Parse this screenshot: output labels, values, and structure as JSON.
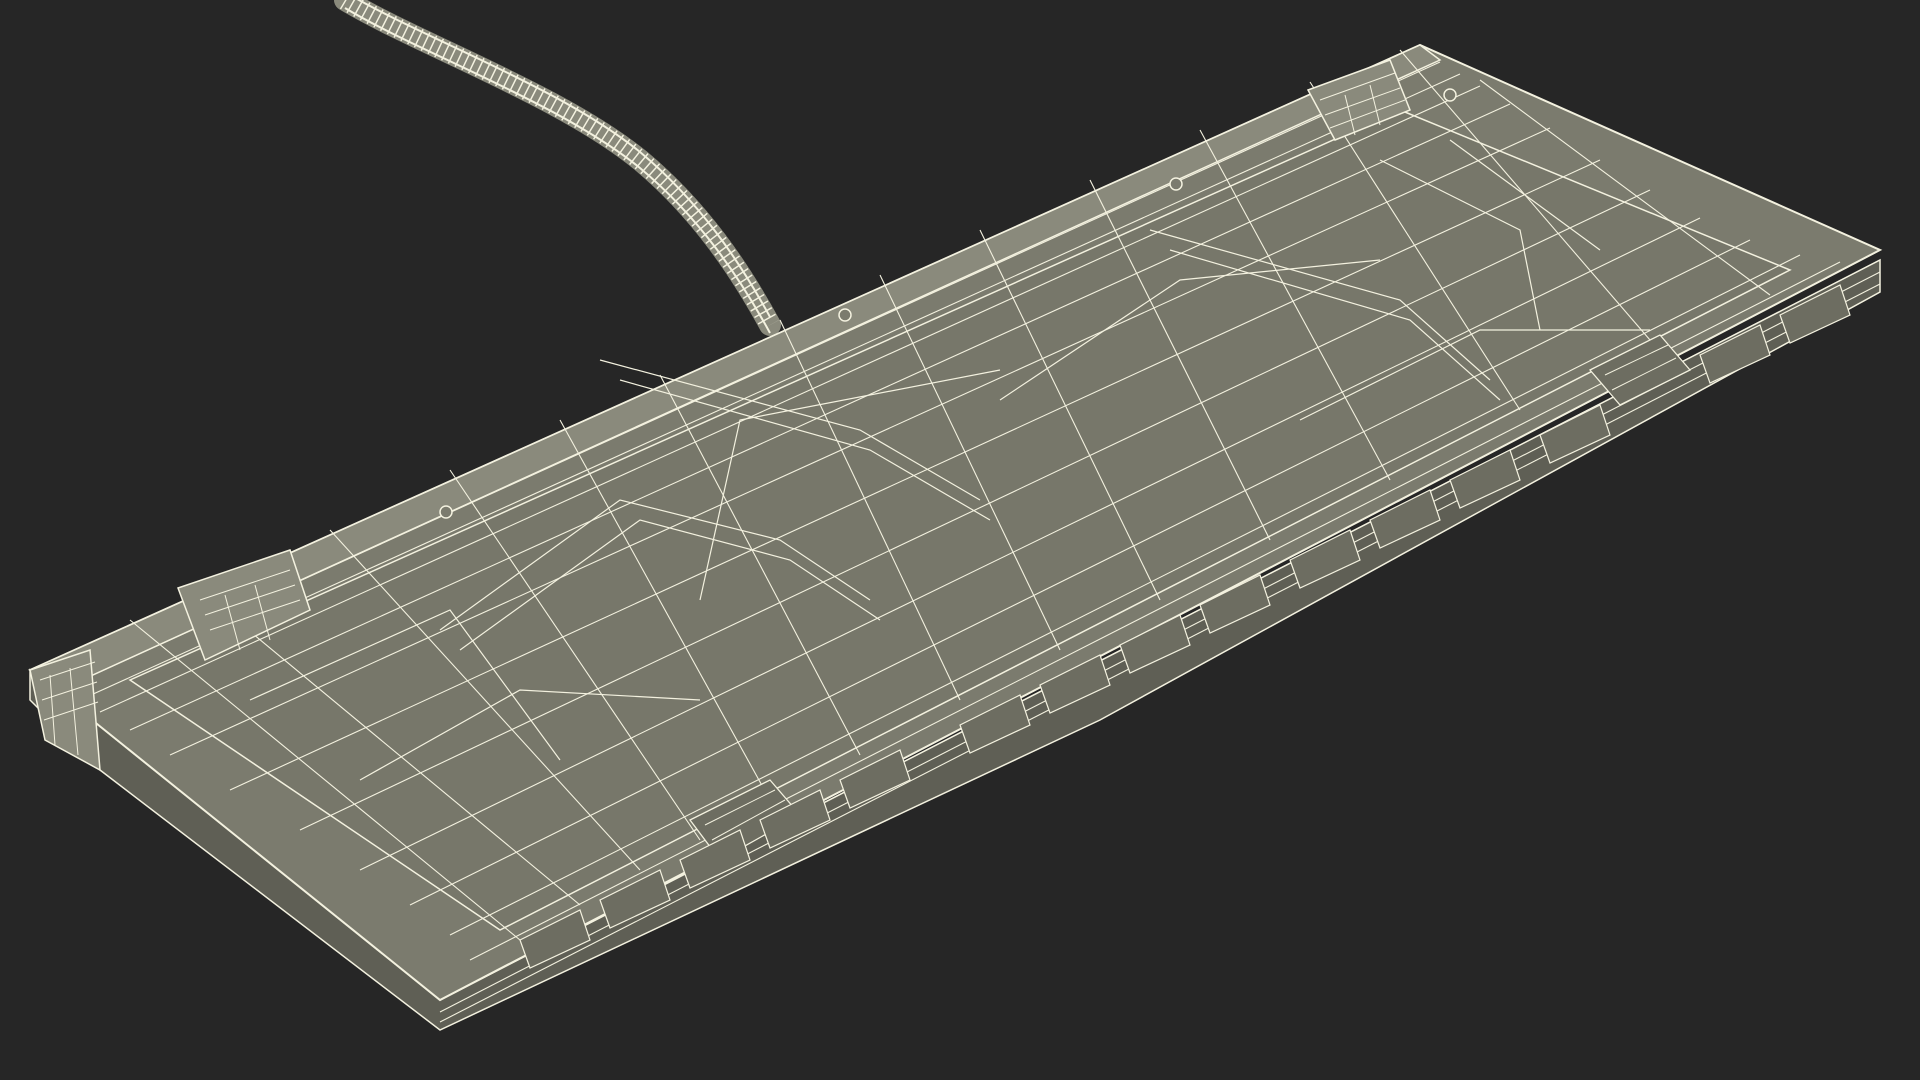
{
  "scene": {
    "subject": "keyboard-underside-wireframe",
    "colors": {
      "background": "#262626",
      "surface_fill": "#7b7b6e",
      "surface_fill_light": "#8a8a7c",
      "edge_fill": "#9a9a8a",
      "wire": "#f3f1df",
      "wire_dim": "#e7e4cf",
      "shadow_fill": "#5f5f55"
    }
  }
}
